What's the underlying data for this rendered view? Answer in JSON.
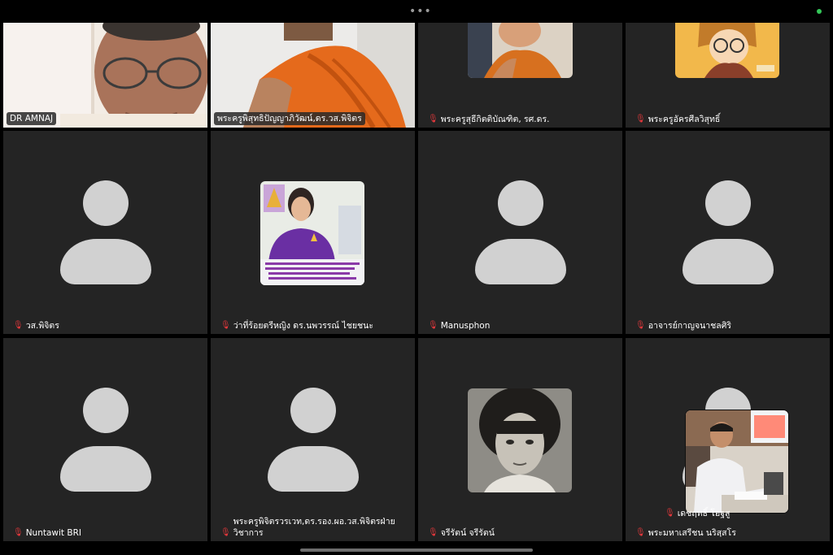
{
  "top_bar": {
    "more_glyph": "•••",
    "status_color": "#34c759"
  },
  "participants": [
    {
      "name": "DR AMNAJ",
      "muted": false,
      "video": "face-glasses"
    },
    {
      "name": "พระครูพิสุทธิปัญญาภิวัฒน์,ดร.วส.พิจิตร",
      "muted": false,
      "video": "monk-robe"
    },
    {
      "name": "พระครูสุธีกิตติบัณฑิต, รศ.ดร.",
      "muted": true,
      "video": "monk-thumb"
    },
    {
      "name": "พระครูอัครศีลวิสุทธิ์",
      "muted": true,
      "video": "cartoon-thumb"
    },
    {
      "name": "วส.พิจิตร",
      "muted": true,
      "video": "avatar"
    },
    {
      "name": "ว่าที่ร้อยตรีหญิง ดร.นพวรรณ์ ไชยชนะ",
      "muted": true,
      "video": "woman-thumb"
    },
    {
      "name": "Manusphon",
      "muted": true,
      "video": "avatar"
    },
    {
      "name": "อาจารย์กาญจนาชลศิริ",
      "muted": true,
      "video": "avatar"
    },
    {
      "name": "Nuntawit BRI",
      "muted": true,
      "video": "avatar"
    },
    {
      "name": "พระครูพิจิตรวรเวท,ดร.รอง.ผอ.วส.พิจิตรฝ่ายวิชาการ",
      "muted": true,
      "video": "avatar"
    },
    {
      "name": "จรีรัตน์ จรีรัตน์",
      "muted": true,
      "video": "vintage-thumb"
    },
    {
      "name": "พระมหาเสรีชน นริสฺสโร",
      "muted": true,
      "video": "avatar"
    }
  ],
  "self_view": {
    "name": "เดชฤทธิ์ โอฐสู",
    "muted": true
  },
  "colors": {
    "tile_bg": "#242424",
    "active_border": "#8fd84d",
    "mic_muted": "#e8383c",
    "avatar": "#d1d1d1"
  }
}
